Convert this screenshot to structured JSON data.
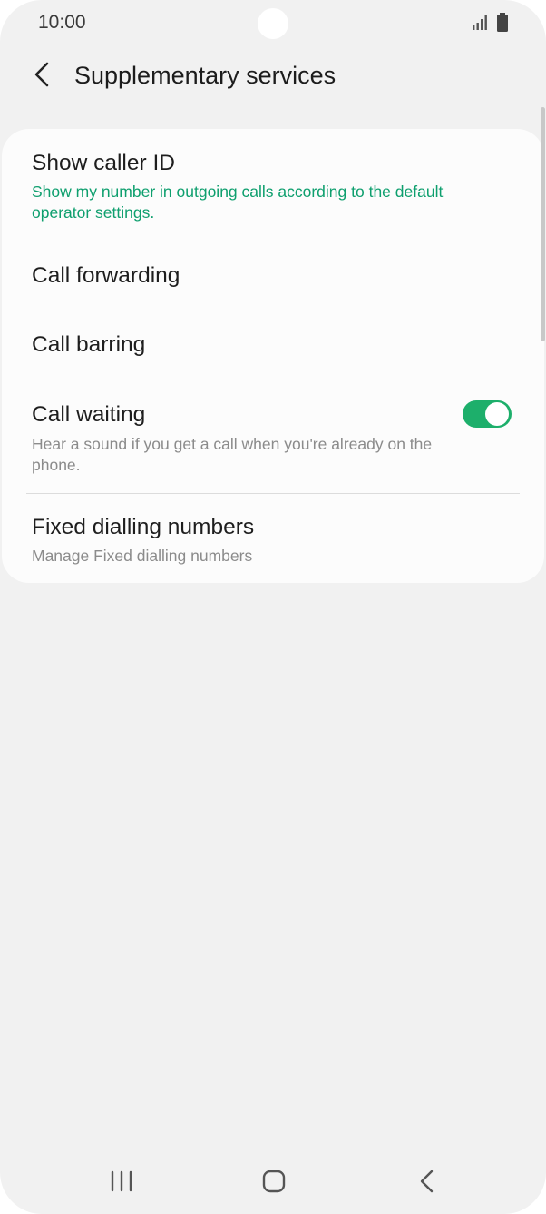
{
  "status_bar": {
    "time": "10:00",
    "icons": [
      "signal-icon",
      "battery-icon"
    ]
  },
  "header": {
    "back_icon": "chevron-left-icon",
    "title": "Supplementary services"
  },
  "settings": [
    {
      "title": "Show caller ID",
      "subtitle": "Show my number in outgoing calls according to the default operator settings.",
      "subtitle_color": "#0e9f6e"
    },
    {
      "title": "Call forwarding"
    },
    {
      "title": "Call barring"
    },
    {
      "title": "Call waiting",
      "subtitle": "Hear a sound if you get a call when you're already on the phone.",
      "toggle_on": true
    },
    {
      "title": "Fixed dialling numbers",
      "subtitle": "Manage Fixed dialling numbers"
    }
  ],
  "nav_bar": {
    "buttons": [
      "recent-apps-icon",
      "home-icon",
      "back-icon"
    ]
  },
  "colors": {
    "accent": "#1daf6b",
    "accent_text": "#0e9f6e",
    "background": "#f1f1f1",
    "card": "#fcfcfc"
  }
}
